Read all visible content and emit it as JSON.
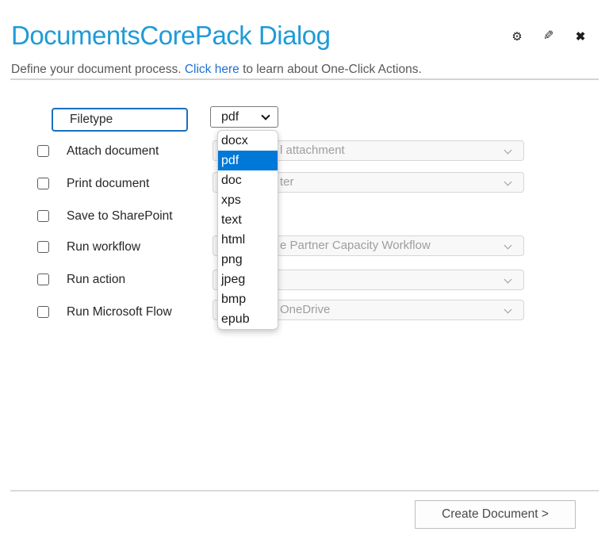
{
  "header": {
    "title": "DocumentsCorePack Dialog",
    "subtitle_prefix": "Define your document process. ",
    "subtitle_link": "Click here",
    "subtitle_suffix": " to learn about One-Click Actions.",
    "icons": {
      "settings": "⚙",
      "edit": "✎",
      "close": "✖"
    }
  },
  "filetype": {
    "label": "Filetype",
    "selected_value": "pdf",
    "options": [
      "docx",
      "pdf",
      "doc",
      "xps",
      "text",
      "html",
      "png",
      "jpeg",
      "bmp",
      "epub"
    ],
    "highlighted_option": "pdf"
  },
  "rows": [
    {
      "label": "Attach document",
      "checked": false,
      "select_visible_text": "l attachment"
    },
    {
      "label": "Print document",
      "checked": false,
      "select_visible_text": "ter"
    },
    {
      "label": "Save to SharePoint",
      "checked": false,
      "select_visible_text": null
    },
    {
      "label": "Run workflow",
      "checked": false,
      "select_visible_text": "e Partner Capacity Workflow"
    },
    {
      "label": "Run action",
      "checked": false,
      "select_visible_text": ""
    },
    {
      "label": "Run Microsoft Flow",
      "checked": false,
      "select_visible_text": "OneDrive"
    }
  ],
  "footer": {
    "create_button_label": "Create Document >"
  },
  "colors": {
    "title_blue": "#1f9bd7",
    "link_blue": "#2170d1",
    "focus_border_blue": "#1b6fc0",
    "option_highlight": "#0078d7"
  }
}
